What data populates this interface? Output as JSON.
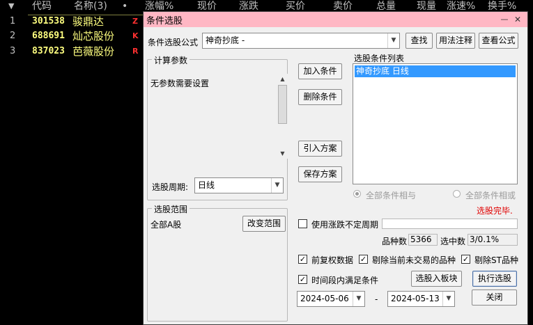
{
  "stock_list": {
    "headers": [
      "代码",
      "名称(3)",
      "•",
      "涨幅%",
      "现价",
      "涨跌",
      "买价",
      "卖价",
      "总量",
      "现量",
      "涨速%",
      "换手%"
    ],
    "rows": [
      {
        "idx": "1",
        "code": "301538",
        "name": "骏鼎达",
        "tag": "Z"
      },
      {
        "idx": "2",
        "code": "688691",
        "name": "灿芯股份",
        "tag": "K"
      },
      {
        "idx": "3",
        "code": "837023",
        "name": "芭薇股份",
        "tag": "R"
      }
    ],
    "colors": {
      "code": "#ffff80",
      "tag": "#ff3030",
      "header": "#c0c0c0"
    }
  },
  "dialog": {
    "title": "条件选股",
    "minimize": "—",
    "close": "✕",
    "formula_label": "条件选股公式",
    "formula_value": "神奇抄底      -",
    "find_button": "查找",
    "usage_button": "用法注释",
    "view_formula_button": "查看公式",
    "params_group": "计算参数",
    "params_text": "无参数需要设置",
    "period_label": "选股周期:",
    "period_value": "日线",
    "add_condition": "加入条件",
    "delete_condition": "删除条件",
    "import_plan": "引入方案",
    "save_plan": "保存方案",
    "condition_list_title": "选股条件列表",
    "condition_items": [
      "神奇抄底  日线"
    ],
    "radio_and": "全部条件相与",
    "radio_or": "全部条件相或",
    "status": "选股完毕.",
    "status_color": "#e00000",
    "range_group": "选股范围",
    "range_value": "全部A股",
    "change_range": "改变范围",
    "use_variable_period": "使用涨跌不定周期",
    "count_label": "品种数",
    "count_value": "5366",
    "selected_label": "选中数",
    "selected_value": "3/0.1%",
    "checkbox_adjust": "前复权数据",
    "checkbox_remove_untraded": "剔除当前未交易的品种",
    "checkbox_remove_st": "剔除ST品种",
    "checkbox_time_range": "时间段内满足条件",
    "to_board_button": "选股入板块",
    "execute_button": "执行选股",
    "date_from": "2024-05-06",
    "date_sep": "-",
    "date_to": "2024-05-13",
    "close_button": "关闭",
    "titlebar_color": "#ffb7c4"
  }
}
